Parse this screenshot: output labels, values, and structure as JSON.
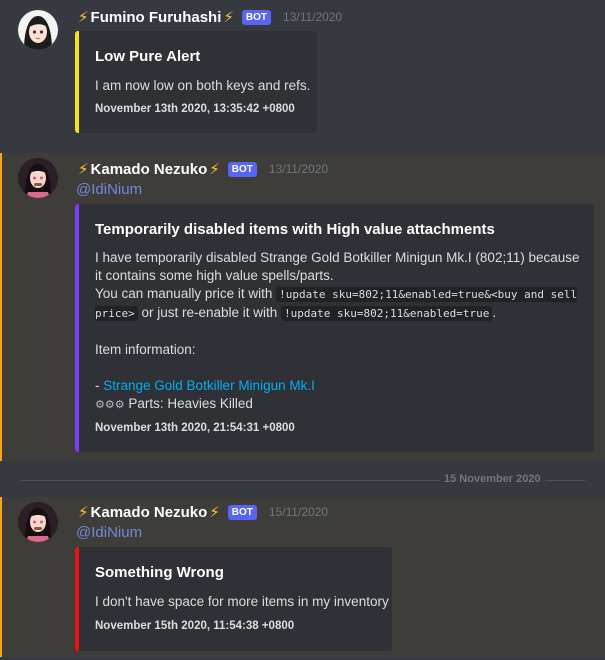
{
  "messages": [
    {
      "author": "Fumino Furuhashi",
      "bot_badge": "BOT",
      "timestamp": "13/11/2020",
      "embed": {
        "color": "#f5e21b",
        "title": "Low Pure Alert",
        "description": "I am now low on both keys and refs.",
        "footer": "November 13th 2020, 13:35:42 +0800"
      }
    },
    {
      "author": "Kamado Nezuko",
      "bot_badge": "BOT",
      "timestamp": "13/11/2020",
      "mention": "@IdiNium",
      "embed": {
        "color": "#7e3ef5",
        "title": "Temporarily disabled items with High value attachments",
        "line1": "I have temporarily disabled Strange Gold Botkiller Minigun Mk.I (802;11) because it contains some high value spells/parts.",
        "line2_pre": "You can manually price it with ",
        "code1": "!update sku=802;11&enabled=true&<buy and sell price>",
        "line2_mid": " or just re-enable it with ",
        "code2": "!update sku=802;11&enabled=true",
        "line2_post": ".",
        "info_heading": "Item information:",
        "item_dash": "- ",
        "item_link": "Strange Gold Botkiller Minigun Mk.I",
        "parts_icons": "⚙⚙⚙",
        "parts_text": " Parts: Heavies Killed",
        "footer": "November 13th 2020, 21:54:31 +0800"
      }
    },
    {
      "author": "Kamado Nezuko",
      "bot_badge": "BOT",
      "timestamp": "15/11/2020",
      "mention": "@IdiNium",
      "embed": {
        "color": "#e81414",
        "title": "Something Wrong",
        "description": "I don't have space for more items in my inventory",
        "footer": "November 15th 2020, 11:54:38 +0800"
      }
    }
  ],
  "date_divider": "15 November 2020",
  "colors": {
    "background": "#36393f",
    "highlight_bg": "#3e3d3a",
    "mention": "#7289da",
    "link": "#00aff4",
    "bot_badge": "#5865f2",
    "bolt": "#f7c43d"
  },
  "icons": {
    "bolt": "⚡",
    "avatar_1": "anime-girl-avatar",
    "avatar_2": "nezuko-avatar"
  }
}
